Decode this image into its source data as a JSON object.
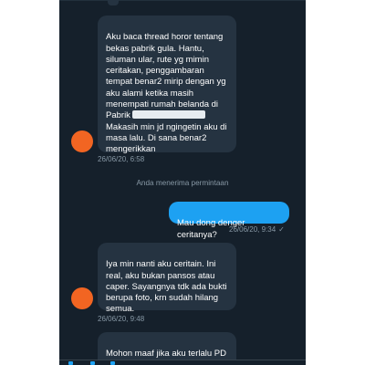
{
  "messages": {
    "m1": {
      "text_before_redaction": "Aku baca thread horor tentang bekas pabrik gula. Hantu, siluman ular, rute yg mimin ceritakan, penggambaran tempat benar2 mirip dengan yg aku alami ketika masih menempati rumah belanda di Pabrik",
      "text_after_redaction": "Makasih min jd ngingetin aku di masa lalu. Di sana benar2 mengerikkan",
      "timestamp": "26/06/20, 6:58"
    },
    "system_notice": "Anda menerima permintaan",
    "m2": {
      "text": "Mau dong denger ceritanya?",
      "timestamp": "26/06/20, 9:34",
      "status_icon": "check-icon"
    },
    "m3": {
      "text": "Iya min nanti aku ceritain. Ini real, aku bukan pansos atau caper. Sayangnya tdk ada bukti berupa foto, krn sudah hilang semua.",
      "timestamp": "26/06/20, 9:48"
    },
    "m4": {
      "text": "Mohon maaf jika aku terlalu PD"
    }
  },
  "colors": {
    "background": "#15202b",
    "received_bubble": "#253341",
    "sent_bubble": "#1da1f2",
    "avatar": "#f26522",
    "muted_text": "#8899a6"
  },
  "icons": [
    "avatar-circle",
    "check-icon",
    "composer-icons"
  ]
}
